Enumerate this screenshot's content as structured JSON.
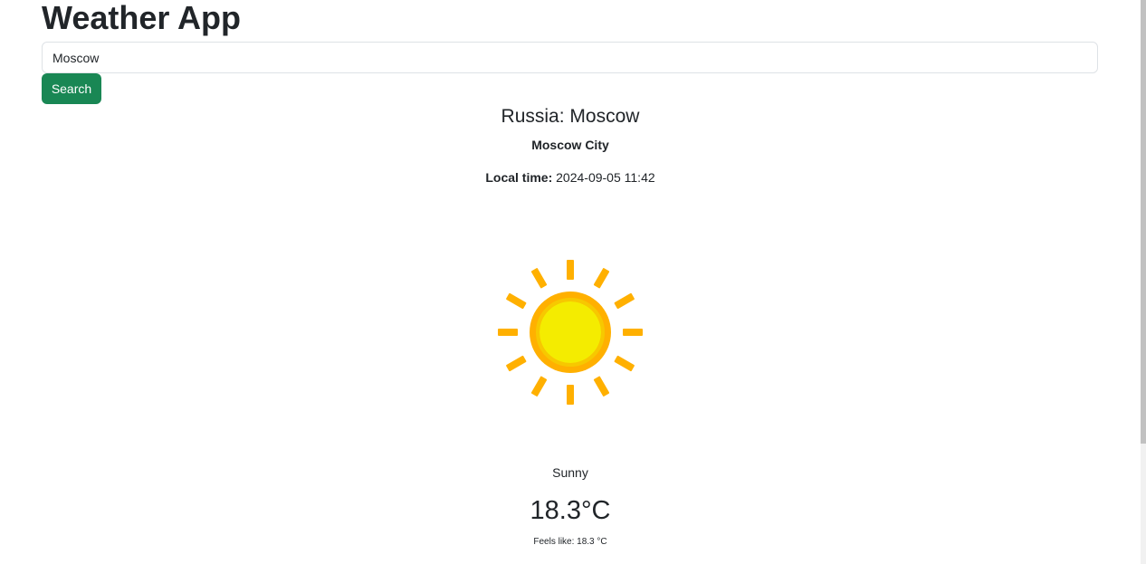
{
  "app": {
    "title": "Weather App"
  },
  "search": {
    "value": "Moscow",
    "button_label": "Search"
  },
  "weather": {
    "location": "Russia: Moscow",
    "region": "Moscow City",
    "local_time_label": "Local time:",
    "local_time_value": "2024-09-05 11:42",
    "icon": "sun-icon",
    "condition": "Sunny",
    "temperature": "18.3°C",
    "feels_like": "Feels like: 18.3 °C"
  },
  "colors": {
    "button_bg": "#198754",
    "sun_outer": "#ffb000",
    "sun_inner": "#f4ec00"
  }
}
